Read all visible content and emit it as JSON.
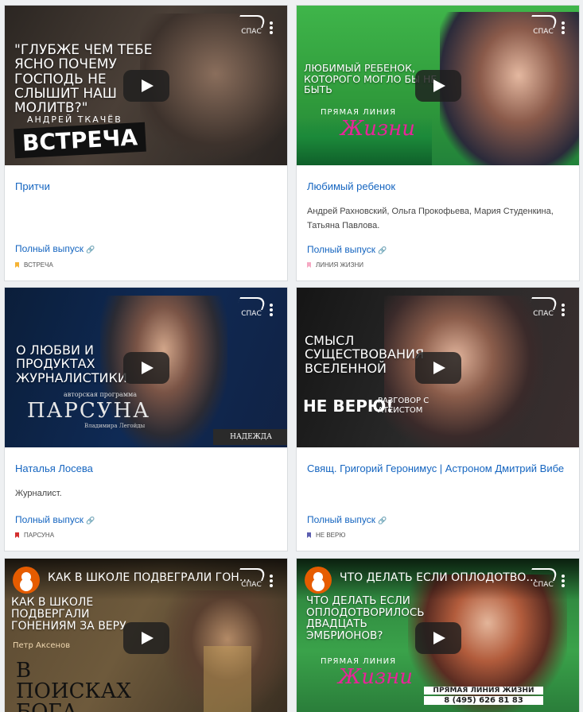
{
  "cards": [
    {
      "thumb_headline": "\"Глубже чем тебе ясно почему Господь не слышит наш молитв?\"",
      "thumb_author": "Андрей Ткачёв",
      "thumb_show": "Встреча",
      "title": "Притчи",
      "description": "",
      "full_label": "Полный выпуск",
      "tag": "Встреча",
      "tag_color": "#f5b335"
    },
    {
      "thumb_headline": "Любимый ребенок, которого могло бы не быть",
      "thumb_show_top": "Прямая линия",
      "thumb_show": "Жизни",
      "title": "Любимый ребенок",
      "description": "Андрей Рахновский, Ольга Прокофьева, Мария Студенкина, Татьяна Павлова.",
      "full_label": "Полный выпуск",
      "tag": "Линия жизни",
      "tag_color": "#f6a9c3"
    },
    {
      "thumb_headline": "О любви и продуктах журналистики",
      "thumb_sub": "авторская программа",
      "thumb_show": "Парсуна",
      "thumb_author": "Владимира Легойды",
      "thumb_badge": "НАДЕЖДА",
      "title": "Наталья Лосева",
      "description": "Журналист.",
      "full_label": "Полный выпуск",
      "tag": "Парсуна",
      "tag_color": "#d32f2f"
    },
    {
      "thumb_headline": "Смысл существования вселенной",
      "thumb_show": "Не верю!",
      "thumb_show_sub": "Разговор с атеистом",
      "title": "Свящ. Григорий Геронимус | Астроном Дмитрий Вибе",
      "description": "",
      "full_label": "Полный выпуск",
      "tag": "Не верю",
      "tag_color": "#5c5fb0"
    },
    {
      "yt_title": "КАК В ШКОЛЕ ПОДВЕГРАЛИ ГОНЕНИЯ ЗА ВЕРУ",
      "thumb_headline": "Как в школе подвергали гонениям за веру",
      "thumb_author": "Петр Аксенов",
      "thumb_show": "В поисках Бога"
    },
    {
      "yt_title": "ЧТО ДЕЛАТЬ ЕСЛИ ОПЛОДОТВОРИЛОСЬ ДВАДЦАТЬ ЭМБРИОНОВ?",
      "thumb_headline": "Что делать если оплодотворилось двадцать эмбрионов?",
      "thumb_show_top": "Прямая линия",
      "thumb_show": "Жизни",
      "thumb_phone_label": "ПРЯМАЯ ЛИНИЯ ЖИЗНИ",
      "thumb_phone": "8 (495) 626 81 83"
    }
  ],
  "channel_logo": "СПАС"
}
